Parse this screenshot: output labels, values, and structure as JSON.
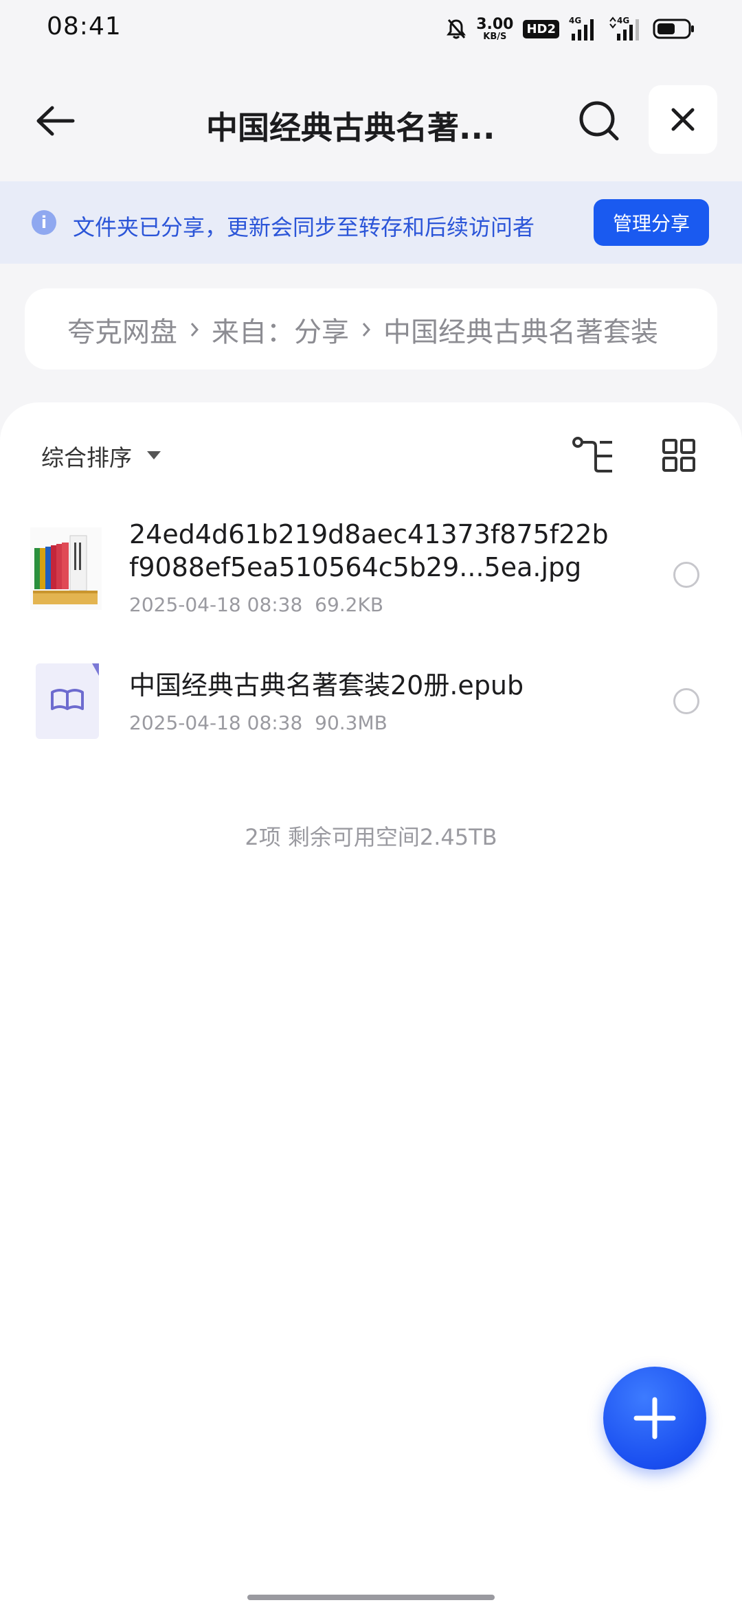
{
  "status_bar": {
    "time": "08:41",
    "net_speed_value": "3.00",
    "net_speed_unit": "KB/S",
    "hd_badge": "HD2",
    "signal_1": "4G",
    "signal_2": "4G",
    "battery_level": 0.6
  },
  "header": {
    "title": "中国经典古典名著...",
    "icons": [
      "back-arrow-icon",
      "search-icon",
      "close-icon"
    ]
  },
  "share_banner": {
    "text": "文件夹已分享，更新会同步至转存和后续访问者",
    "button_label": "管理分享"
  },
  "breadcrumb": {
    "items": [
      "夸克网盘",
      "来自：分享",
      "中国经典古典名著套装"
    ]
  },
  "toolbar": {
    "sort_label": "综合排序"
  },
  "files": [
    {
      "name": "24ed4d61b219d8aec41373f875f22bf9088ef5ea510564c5b29...5ea.jpg",
      "date": "2025-04-18 08:38",
      "size": "69.2KB",
      "type": "image"
    },
    {
      "name": "中国经典古典名著套装20册.epub",
      "date": "2025-04-18 08:38",
      "size": "90.3MB",
      "type": "epub"
    }
  ],
  "summary": "2项 剩余可用空间2.45TB",
  "colors": {
    "accent": "#1a5af0",
    "banner_bg": "#e8ecf8",
    "banner_text": "#2b55d8"
  }
}
